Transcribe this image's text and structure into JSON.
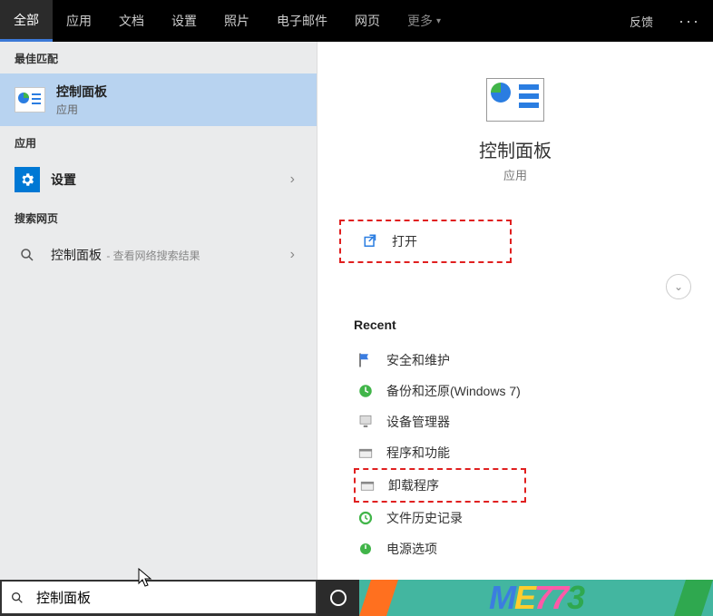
{
  "topbar": {
    "tabs": [
      "全部",
      "应用",
      "文档",
      "设置",
      "照片",
      "电子邮件",
      "网页",
      "更多"
    ],
    "feedback": "反馈",
    "more": "···"
  },
  "left": {
    "best_match_header": "最佳匹配",
    "best_match": {
      "title": "控制面板",
      "sub": "应用"
    },
    "apps_header": "应用",
    "settings_item": "设置",
    "web_header": "搜索网页",
    "web_item_title": "控制面板",
    "web_item_sub": " - 查看网络搜索结果"
  },
  "right": {
    "hero_title": "控制面板",
    "hero_sub": "应用",
    "open_label": "打开",
    "recent_header": "Recent",
    "recent": [
      "安全和维护",
      "备份和还原(Windows 7)",
      "设备管理器",
      "程序和功能",
      "卸载程序",
      "文件历史记录",
      "电源选项"
    ]
  },
  "search": {
    "value": "控制面板"
  },
  "watermark": {
    "t1": "M",
    "t2": "E",
    "t3": "7",
    "t4": "7",
    "t5": "3"
  }
}
